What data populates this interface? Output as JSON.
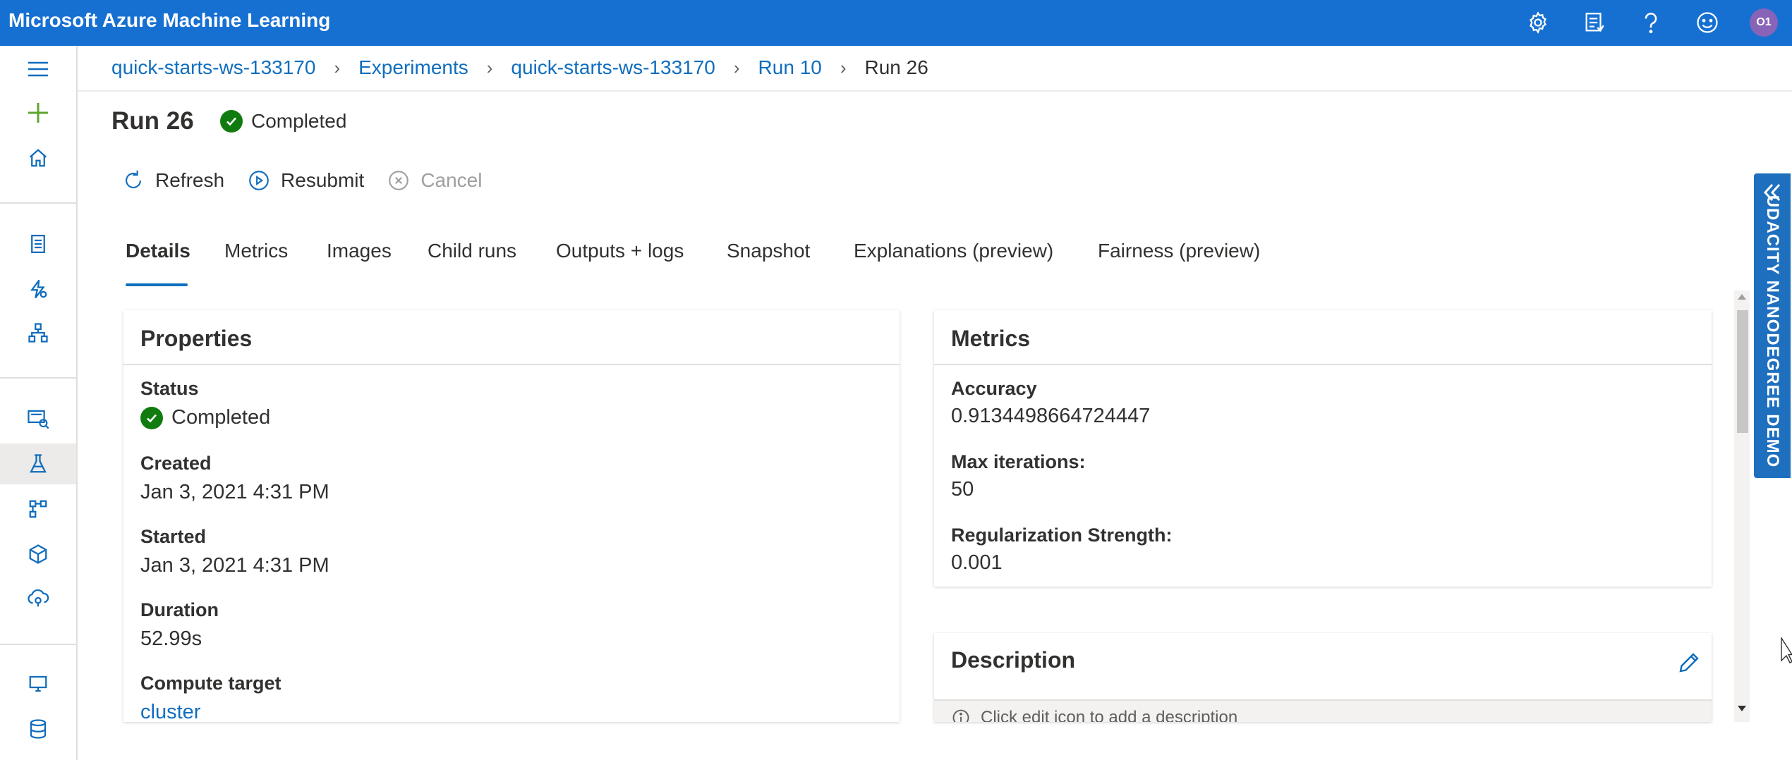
{
  "app": {
    "title": "Microsoft Azure Machine Learning",
    "avatar_initials": "O1"
  },
  "topbar_icons": [
    "gear-icon",
    "feedback-icon",
    "help-icon",
    "smiley-icon"
  ],
  "breadcrumb": {
    "items": [
      "quick-starts-ws-133170",
      "Experiments",
      "quick-starts-ws-133170",
      "Run 10"
    ],
    "current": "Run 26"
  },
  "page": {
    "title": "Run 26",
    "status": "Completed"
  },
  "toolbar": {
    "refresh": "Refresh",
    "resubmit": "Resubmit",
    "cancel": "Cancel"
  },
  "tabs": [
    "Details",
    "Metrics",
    "Images",
    "Child runs",
    "Outputs + logs",
    "Snapshot",
    "Explanations (preview)",
    "Fairness (preview)"
  ],
  "active_tab": "Details",
  "properties": {
    "title": "Properties",
    "status_label": "Status",
    "status_value": "Completed",
    "created_label": "Created",
    "created_value": "Jan 3, 2021 4:31 PM",
    "started_label": "Started",
    "started_value": "Jan 3, 2021 4:31 PM",
    "duration_label": "Duration",
    "duration_value": "52.99s",
    "compute_label": "Compute target",
    "compute_value": "cluster"
  },
  "metrics": {
    "title": "Metrics",
    "accuracy_label": "Accuracy",
    "accuracy_value": "0.9134498664724447",
    "max_iter_label": "Max iterations:",
    "max_iter_value": "50",
    "reg_label": "Regularization Strength:",
    "reg_value": "0.001"
  },
  "description": {
    "title": "Description",
    "hint": "Click edit icon to add a description"
  },
  "side_banner": {
    "label": "UDACITY NANODEGREE DEMO"
  },
  "colors": {
    "brand": "#1670d2",
    "link": "#106ebe",
    "success": "#107c10",
    "banner": "#1f6fbf"
  }
}
